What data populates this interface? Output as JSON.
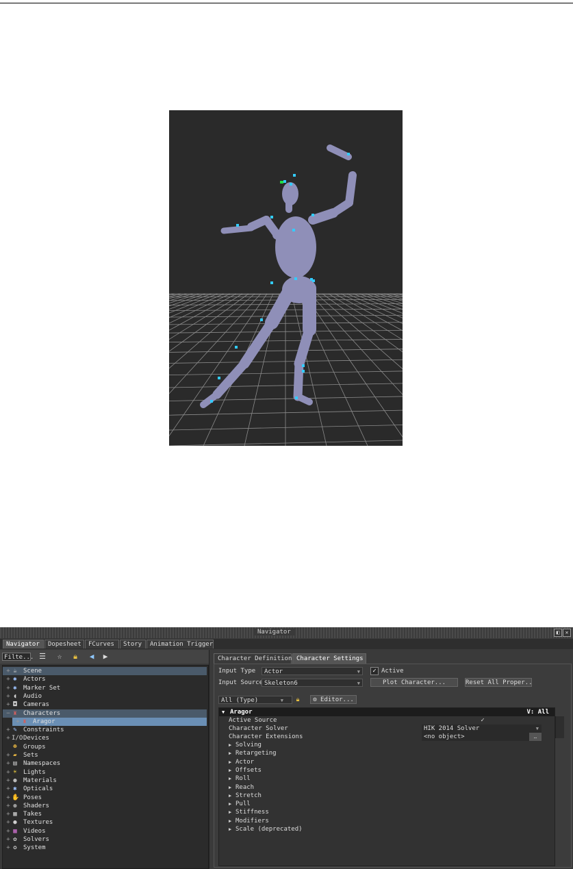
{
  "window": {
    "title": "Navigator",
    "buttons": [
      "◧",
      "✕"
    ]
  },
  "main_tabs": [
    {
      "label": "Navigator",
      "active": true
    },
    {
      "label": "Dopesheet",
      "active": false
    },
    {
      "label": "FCurves",
      "active": false
    },
    {
      "label": "Story",
      "active": false
    },
    {
      "label": "Animation Trigger",
      "active": false
    }
  ],
  "navigator": {
    "filter_label": "Filte...",
    "toolbar_icons": [
      "list-icon",
      "select-icon",
      "lock-icon",
      "back-arrow-icon",
      "forward-arrow-icon"
    ],
    "tree": [
      {
        "label": "Scene",
        "expander": "+",
        "icon": "scene-icon",
        "glyph": "☕",
        "color": "#cfcfcf",
        "state": "sel"
      },
      {
        "label": "Actors",
        "expander": "+",
        "icon": "actors-icon",
        "glyph": "✱",
        "color": "#9fc4ff",
        "state": ""
      },
      {
        "label": "Marker Set",
        "expander": "+",
        "icon": "marker-set-icon",
        "glyph": "✱",
        "color": "#9fc4ff",
        "state": ""
      },
      {
        "label": "Audio",
        "expander": "+",
        "icon": "audio-icon",
        "glyph": "◖",
        "color": "#cfcfcf",
        "state": ""
      },
      {
        "label": "Cameras",
        "expander": "+",
        "icon": "cameras-icon",
        "glyph": "◘",
        "color": "#cfcfcf",
        "state": ""
      },
      {
        "label": "Characters",
        "expander": "−",
        "icon": "characters-icon",
        "glyph": "♜",
        "color": "#d06060",
        "state": "sel"
      },
      {
        "label": "Aragor",
        "expander": "+",
        "icon": "character-icon",
        "glyph": "♜",
        "color": "#d06060",
        "state": "sel2",
        "indent": true
      },
      {
        "label": "Constraints",
        "expander": "+",
        "icon": "constraints-icon",
        "glyph": "✎",
        "color": "#9fc4ff",
        "state": ""
      },
      {
        "label": "Devices",
        "expander": "+",
        "icon": "devices-icon",
        "glyph": "I/O",
        "color": "#cfcfcf",
        "state": ""
      },
      {
        "label": "Groups",
        "expander": "",
        "icon": "groups-icon",
        "glyph": "☻",
        "color": "#e0b040",
        "state": ""
      },
      {
        "label": "Sets",
        "expander": "+",
        "icon": "sets-icon",
        "glyph": "▰",
        "color": "#e0b040",
        "state": ""
      },
      {
        "label": "Namespaces",
        "expander": "+",
        "icon": "namespaces-icon",
        "glyph": "▤",
        "color": "#cfcfcf",
        "state": ""
      },
      {
        "label": "Lights",
        "expander": "+",
        "icon": "lights-icon",
        "glyph": "☀",
        "color": "#f0d040",
        "state": ""
      },
      {
        "label": "Materials",
        "expander": "+",
        "icon": "materials-icon",
        "glyph": "●",
        "color": "#bbbbbb",
        "state": ""
      },
      {
        "label": "Opticals",
        "expander": "+",
        "icon": "opticals-icon",
        "glyph": "✱",
        "color": "#9fc4ff",
        "state": ""
      },
      {
        "label": "Poses",
        "expander": "+",
        "icon": "poses-icon",
        "glyph": "✋",
        "color": "#cfcfcf",
        "state": ""
      },
      {
        "label": "Shaders",
        "expander": "+",
        "icon": "shaders-icon",
        "glyph": "●",
        "color": "#999999",
        "state": ""
      },
      {
        "label": "Takes",
        "expander": "+",
        "icon": "takes-icon",
        "glyph": "▦",
        "color": "#cfcfcf",
        "state": ""
      },
      {
        "label": "Textures",
        "expander": "+",
        "icon": "textures-icon",
        "glyph": "●",
        "color": "#cfcfcf",
        "state": ""
      },
      {
        "label": "Videos",
        "expander": "+",
        "icon": "videos-icon",
        "glyph": "▦",
        "color": "#d070d0",
        "state": ""
      },
      {
        "label": "Solvers",
        "expander": "+",
        "icon": "solvers-icon",
        "glyph": "✿",
        "color": "#cfcfcf",
        "state": ""
      },
      {
        "label": "System",
        "expander": "+",
        "icon": "system-icon",
        "glyph": "✪",
        "color": "#cfcfcf",
        "state": ""
      }
    ]
  },
  "character_panel": {
    "tabs": [
      {
        "label": "Character Definition",
        "active": false
      },
      {
        "label": "Character Settings",
        "active": true
      }
    ],
    "input_type_label": "Input Type",
    "input_type_value": "Actor",
    "active_label": "Active",
    "active_checked": "✓",
    "input_source_label": "Input Source",
    "input_source_value": "Skeleton6",
    "plot_button": "Plot Character...",
    "reset_button": "Reset All Proper...",
    "filter_value": "All (Type)",
    "editor_button": "Editor...",
    "section_title": "Aragor",
    "section_right": "V: All",
    "properties": [
      {
        "label": "Active Source",
        "value": "✓",
        "kind": "check"
      },
      {
        "label": "Character Solver",
        "value": "HIK 2014 Solver",
        "kind": "dropdown"
      },
      {
        "label": "Character Extensions",
        "value": "<no object>",
        "kind": "object"
      }
    ],
    "groups": [
      "Solving",
      "Retargeting",
      "Actor",
      "Offsets",
      "Roll",
      "Reach",
      "Stretch",
      "Pull",
      "Stiffness",
      "Modifiers",
      "Scale (deprecated)"
    ]
  },
  "colors": {
    "viewport_bg": "#2a2a2a",
    "mannequin": "#8f8fb8",
    "marker": "#33ccff",
    "marker_selected": "#22dd44",
    "grid": "#8c8c8c"
  }
}
